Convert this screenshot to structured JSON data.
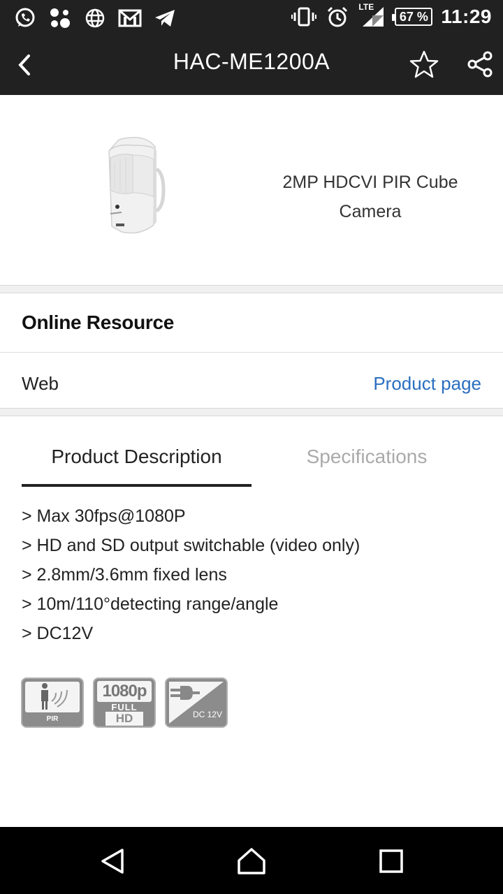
{
  "status_bar": {
    "left_icons": [
      "whatsapp-icon",
      "apps-icon",
      "globe-icon",
      "gmail-icon",
      "telegram-icon"
    ],
    "right_icons": [
      "vibrate-icon",
      "alarm-icon",
      "lte-signal-icon"
    ],
    "network": "LTE",
    "battery": "67 %",
    "time": "11:29"
  },
  "app_bar": {
    "title": "HAC-ME1200A",
    "icons": [
      "back-icon",
      "star-icon",
      "share-icon"
    ]
  },
  "product": {
    "name": "2MP HDCVI PIR Cube Camera"
  },
  "online_resource": {
    "title": "Online Resource",
    "row_label": "Web",
    "link_text": "Product page"
  },
  "tabs": {
    "items": [
      "Product Description",
      "Specifications"
    ],
    "active": "Product Description"
  },
  "description": {
    "items": [
      "> Max 30fps@1080P",
      "> HD and SD output switchable (video only)",
      "> 2.8mm/3.6mm fixed lens",
      "> 10m/110°detecting range/angle",
      "> DC12V"
    ]
  },
  "badges": [
    {
      "icon": "pir-icon",
      "label": "PIR"
    },
    {
      "icon": "full-hd-icon",
      "label": "1080p",
      "sub": "FULL",
      "sub2": "HD"
    },
    {
      "icon": "dc12v-icon",
      "label": "DC 12V"
    }
  ],
  "nav_bar": {
    "icons": [
      "back-triangle-icon",
      "home-icon",
      "recents-icon"
    ]
  },
  "colors": {
    "bar_background": "#212121",
    "link": "#2a6fc0",
    "inactive_tab": "#aaaaaa",
    "badge_grey": "#8a8a8a"
  }
}
